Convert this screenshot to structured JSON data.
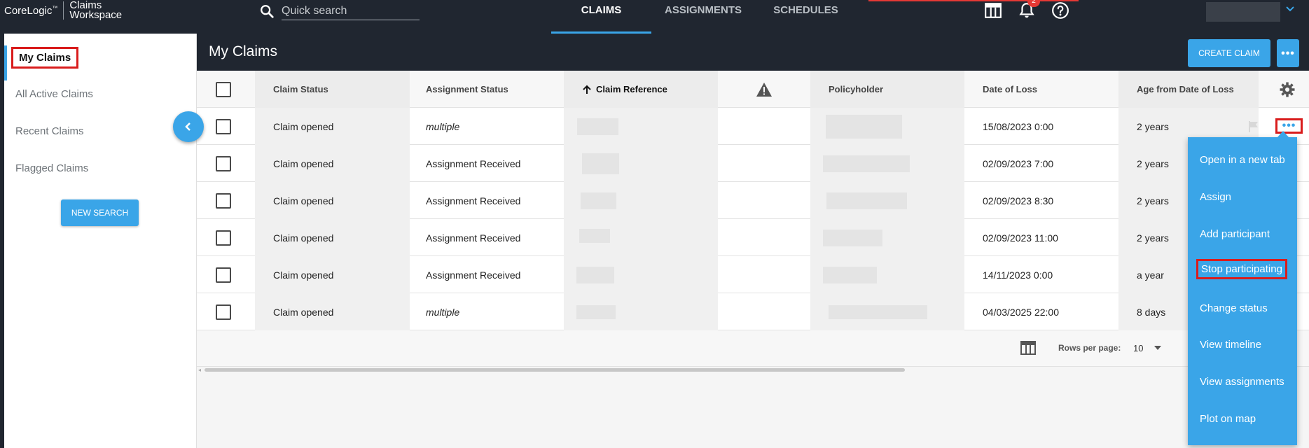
{
  "app": {
    "brand": "CoreLogic",
    "product": "Claims Workspace",
    "brand_mark": "™"
  },
  "search": {
    "placeholder": "Quick search"
  },
  "nav": {
    "tabs": [
      {
        "label": "CLAIMS",
        "active": true
      },
      {
        "label": "ASSIGNMENTS",
        "active": false
      },
      {
        "label": "SCHEDULES",
        "active": false
      }
    ]
  },
  "notifications": {
    "count": "2"
  },
  "sidebar": {
    "items": [
      {
        "label": "My Claims",
        "active": true
      },
      {
        "label": "All Active Claims"
      },
      {
        "label": "Recent Claims"
      },
      {
        "label": "Flagged Claims"
      }
    ],
    "new_search_label": "NEW SEARCH"
  },
  "page": {
    "title": "My Claims",
    "create_label": "CREATE CLAIM"
  },
  "table": {
    "headers": {
      "claim_status": "Claim Status",
      "assignment_status": "Assignment Status",
      "claim_reference": "Claim Reference",
      "policyholder": "Policyholder",
      "date_of_loss": "Date of Loss",
      "age": "Age from Date of Loss"
    },
    "sort": {
      "column": "claim_reference",
      "direction": "ascending"
    },
    "rows": [
      {
        "claim_status": "Claim opened",
        "assignment_status": "multiple",
        "date_of_loss": "15/08/2023 0:00",
        "age": "2 years"
      },
      {
        "claim_status": "Claim opened",
        "assignment_status": "Assignment Received",
        "date_of_loss": "02/09/2023 7:00",
        "age": "2 years"
      },
      {
        "claim_status": "Claim opened",
        "assignment_status": "Assignment Received",
        "date_of_loss": "02/09/2023 8:30",
        "age": "2 years"
      },
      {
        "claim_status": "Claim opened",
        "assignment_status": "Assignment Received",
        "date_of_loss": "02/09/2023 11:00",
        "age": "2 years"
      },
      {
        "claim_status": "Claim opened",
        "assignment_status": "Assignment Received",
        "date_of_loss": "14/11/2023 0:00",
        "age": "a year"
      },
      {
        "claim_status": "Claim opened",
        "assignment_status": "multiple",
        "date_of_loss": "04/03/2025 22:00",
        "age": "8 days"
      }
    ],
    "rows_per_page_label": "Rows per page:",
    "rows_per_page_value": "10"
  },
  "context_menu": {
    "items": [
      {
        "label": "Open in a new tab"
      },
      {
        "label": "Assign"
      },
      {
        "label": "Add participant"
      },
      {
        "label": "Stop participating",
        "highlighted": true
      },
      {
        "label": "Change status"
      },
      {
        "label": "View timeline"
      },
      {
        "label": "View assignments"
      },
      {
        "label": "Plot on map"
      }
    ]
  },
  "colors": {
    "topbar": "#202630",
    "accent": "#3aa5e8",
    "highlight": "#d91c1c"
  }
}
